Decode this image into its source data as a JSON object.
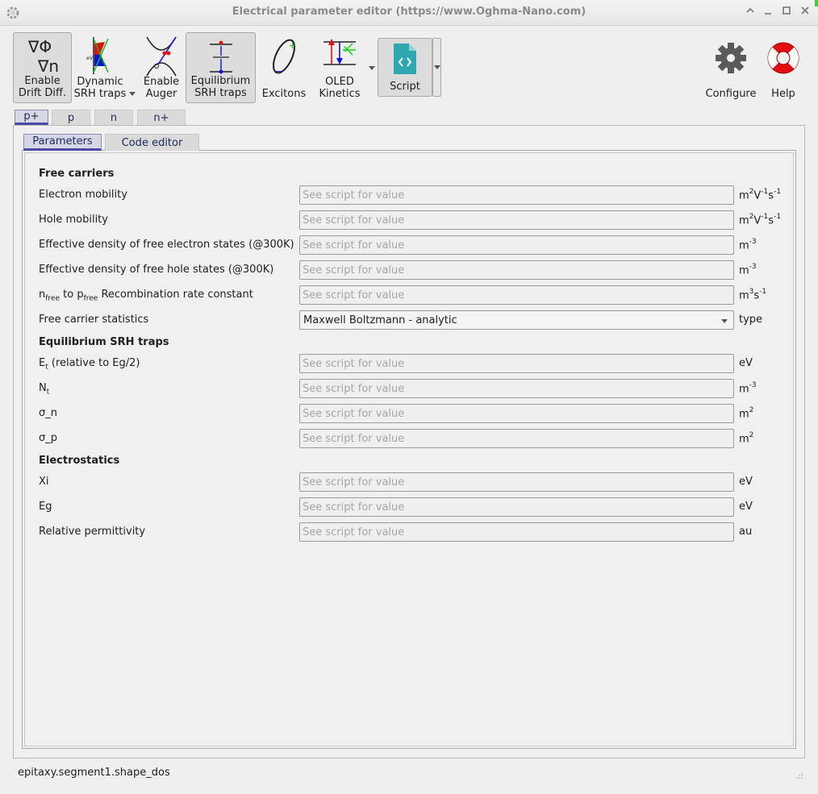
{
  "window": {
    "title": "Electrical parameter editor (https://www.Oghma-Nano.com)"
  },
  "toolbar": {
    "drift_diff": "Enable\nDrift Diff.",
    "dynamic_srh": "Dynamic\nSRH traps",
    "auger": "Enable\nAuger",
    "equilibrium_srh": "Equilibrium\nSRH traps",
    "excitons": "Excitons",
    "oled": "OLED\nKinetics",
    "script": "Script",
    "configure": "Configure",
    "help": "Help"
  },
  "layer_tabs": [
    "p+",
    "p",
    "n",
    "n+"
  ],
  "inner_tabs": [
    "Parameters",
    "Code editor"
  ],
  "placeholder": "See script for value",
  "sections": {
    "free_carriers": "Free carriers",
    "equilibrium_srh": "Equilibrium SRH traps",
    "electrostatics": "Electrostatics"
  },
  "rows": {
    "electron_mobility": {
      "label": "Electron mobility"
    },
    "hole_mobility": {
      "label": "Hole mobility"
    },
    "eff_dos_electron": {
      "label": "Effective density of free electron states (@300K)"
    },
    "eff_dos_hole": {
      "label": "Effective density of free hole states (@300K)"
    },
    "recomb": {
      "label_pre": "n",
      "label_sub1": "free",
      "label_mid": " to p",
      "label_sub2": "free",
      "label_post": " Recombination rate constant"
    },
    "statistics": {
      "label": "Free carrier statistics",
      "value": "Maxwell Boltzmann - analytic",
      "unit": "type"
    },
    "et": {
      "label_pre": "E",
      "label_sub": "t",
      "label_post": " (relative to Eg/2)",
      "unit": "eV"
    },
    "nt": {
      "label_pre": "N",
      "label_sub": "t"
    },
    "sigma_n": {
      "label": "σ_n"
    },
    "sigma_p": {
      "label": "σ_p"
    },
    "xi": {
      "label": "Xi",
      "unit": "eV"
    },
    "eg": {
      "label": "Eg",
      "unit": "eV"
    },
    "permittivity": {
      "label": "Relative permittivity",
      "unit": "au"
    }
  },
  "units": {
    "m": "m",
    "v": "V",
    "s": "s",
    "sup_2": "2",
    "sup_m1": "-1",
    "sup_m3": "-3",
    "sup_3": "3"
  },
  "status": "epitaxy.segment1.shape_dos"
}
